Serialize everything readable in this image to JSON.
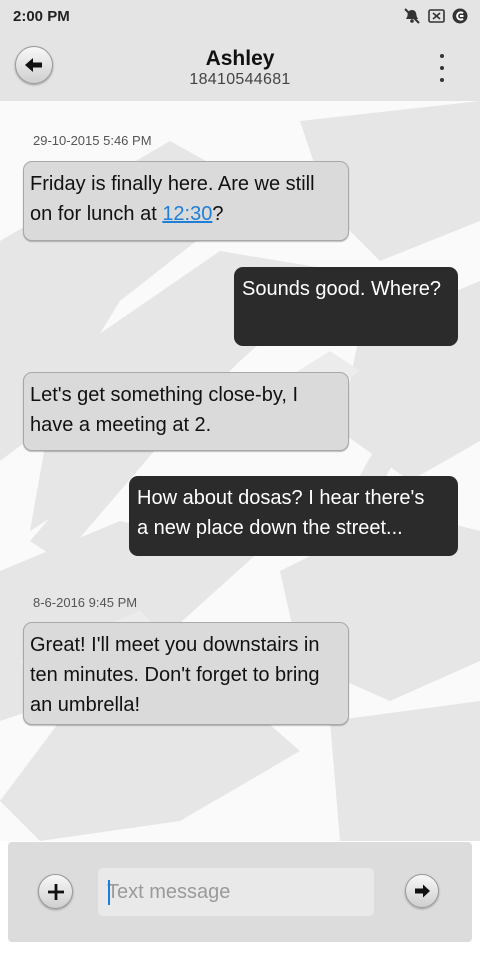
{
  "status_bar": {
    "time": "2:00 PM",
    "icons": [
      "mute-icon",
      "sim-blocked-icon",
      "app-notification-icon"
    ]
  },
  "header": {
    "contact_name": "Ashley",
    "contact_number": "18410544681",
    "back_icon": "arrow-left-icon",
    "menu_icon": "more-vertical-icon"
  },
  "conversation": {
    "messages": [
      {
        "timestamp": "29-10-2015 5:46 PM",
        "direction": "incoming",
        "line1": "Friday is finally here. Are we still",
        "line2_prefix": "on for lunch at ",
        "link": "12:30",
        "line2_suffix": "?"
      },
      {
        "direction": "outgoing",
        "line1": "Sounds good. Where?"
      },
      {
        "direction": "incoming",
        "line1": "Let's get something close-by, I",
        "line2": "have a meeting at 2."
      },
      {
        "direction": "outgoing",
        "line1": "How about dosas? I hear there's",
        "line2": "a new place down the street..."
      },
      {
        "timestamp": "8-6-2016 9:45 PM",
        "direction": "incoming",
        "line1": "Great! I'll meet you downstairs in",
        "line2": "ten minutes. Don't forget to bring",
        "line3": "an umbrella!"
      }
    ]
  },
  "composer": {
    "placeholder": "Text message",
    "value": "",
    "add_icon": "plus-icon",
    "send_icon": "arrow-right-icon"
  },
  "colors": {
    "bar_background": "#e4e4e4",
    "incoming_bubble": "#dadada",
    "outgoing_bubble": "#2b2b2b",
    "link": "#1f7fd6"
  }
}
